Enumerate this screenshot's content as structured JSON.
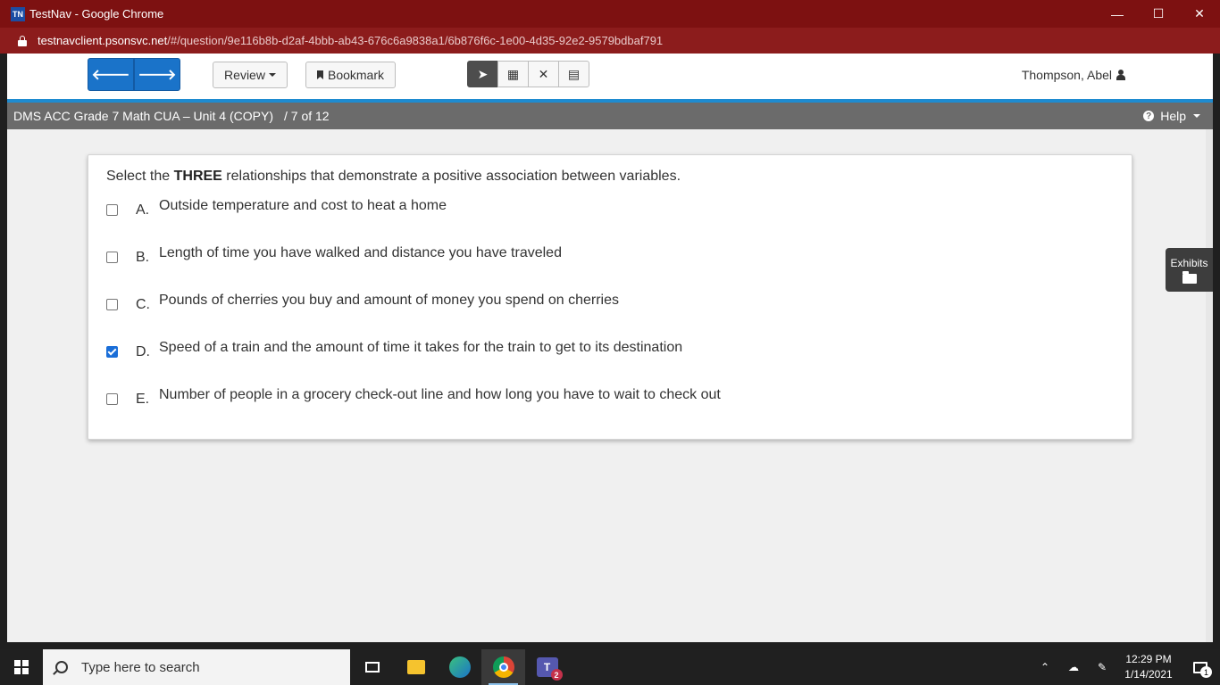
{
  "window": {
    "favicon_text": "TN",
    "title": "TestNav - Google Chrome",
    "minimize_glyph": "—",
    "maximize_glyph": "☐",
    "close_glyph": "✕"
  },
  "address": {
    "host": "testnavclient.psonsvc.net",
    "path": "/#/question/9e116b8b-d2af-4bbb-ab43-676c6a9838a1/6b876f6c-1e00-4d35-92e2-9579bdbaf791"
  },
  "toolbar": {
    "back_glyph": "🡐",
    "forward_glyph": "🡒",
    "review_label": "Review",
    "bookmark_label": "Bookmark",
    "tools": [
      {
        "name": "pointer",
        "glyph": "➤",
        "active": true
      },
      {
        "name": "calculator",
        "glyph": "▦",
        "active": false
      },
      {
        "name": "answer-eliminator",
        "glyph": "✕",
        "active": false
      },
      {
        "name": "notepad",
        "glyph": "▤",
        "active": false
      }
    ],
    "user_name": "Thompson, Abel"
  },
  "testbar": {
    "test_title": "DMS ACC Grade 7 Math CUA – Unit 4 (COPY)",
    "position": "/  7 of 12",
    "help_label": "Help",
    "help_icon": "?"
  },
  "question": {
    "prompt_before": "Select the ",
    "prompt_emphasis": "THREE",
    "prompt_after": " relationships that demonstrate a positive association between variables.",
    "options": [
      {
        "letter": "A.",
        "text": "Outside temperature and cost to heat a home",
        "checked": false
      },
      {
        "letter": "B.",
        "text": "Length of time you have walked and distance you have traveled",
        "checked": false
      },
      {
        "letter": "C.",
        "text": "Pounds of cherries you buy and amount of money you spend on cherries",
        "checked": false
      },
      {
        "letter": "D.",
        "text": "Speed of a train and the amount of time it takes for the train to get to its destination",
        "checked": true
      },
      {
        "letter": "E.",
        "text": "Number of people in a grocery check-out line and how long you have to wait to check out",
        "checked": false
      }
    ]
  },
  "exhibits": {
    "label": "Exhibits"
  },
  "taskbar": {
    "search_placeholder": "Type here to search",
    "teams_label": "T",
    "teams_badge": "2",
    "clock_time": "12:29 PM",
    "clock_date": "1/14/2021",
    "notification_count": "1",
    "tray_up_glyph": "⌃",
    "tray_cloud_glyph": "☁",
    "tray_pen_glyph": "✎"
  }
}
